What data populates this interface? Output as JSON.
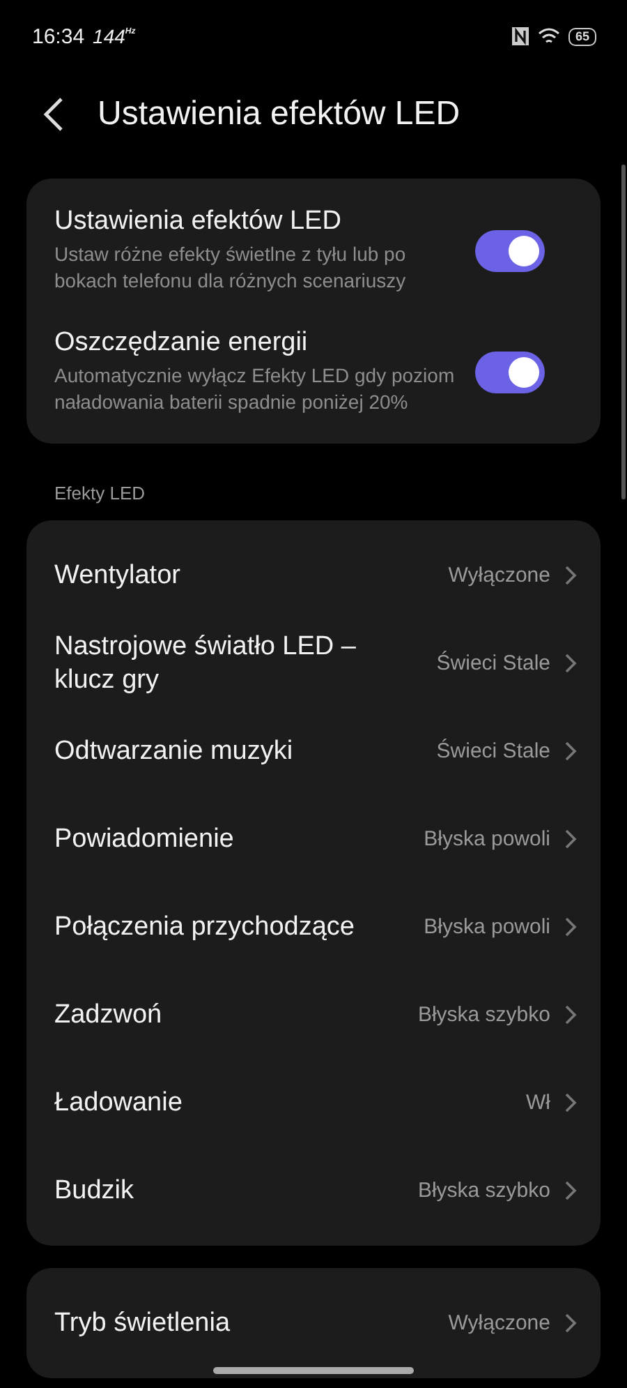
{
  "status_bar": {
    "time": "16:34",
    "refresh_rate": "144",
    "refresh_unit": "Hz",
    "battery": "65"
  },
  "header": {
    "title": "Ustawienia efektów LED"
  },
  "toggles": [
    {
      "title": "Ustawienia efektów LED",
      "description": "Ustaw różne efekty świetlne z tyłu lub po bokach telefonu dla różnych scenariuszy",
      "on": true
    },
    {
      "title": "Oszczędzanie energii",
      "description": "Automatycznie wyłącz Efekty LED gdy poziom naładowania baterii spadnie poniżej 20%",
      "on": true
    }
  ],
  "section_label": "Efekty LED",
  "effects": [
    {
      "label": "Wentylator",
      "value": "Wyłączone"
    },
    {
      "label": "Nastrojowe światło LED – klucz gry",
      "value": "Świeci Stale"
    },
    {
      "label": "Odtwarzanie muzyki",
      "value": "Świeci Stale"
    },
    {
      "label": "Powiadomienie",
      "value": "Błyska powoli"
    },
    {
      "label": "Połączenia przychodzące",
      "value": "Błyska powoli"
    },
    {
      "label": "Zadzwoń",
      "value": "Błyska szybko"
    },
    {
      "label": "Ładowanie",
      "value": "Wł"
    },
    {
      "label": "Budzik",
      "value": "Błyska szybko"
    }
  ],
  "more": [
    {
      "label": "Tryb świetlenia",
      "value": "Wyłączone"
    }
  ]
}
